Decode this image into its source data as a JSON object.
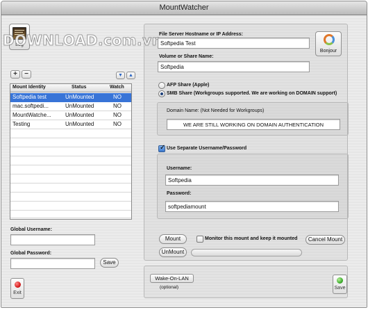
{
  "window": {
    "title": "MountWatcher"
  },
  "watermark": "DOWNLOAD.com.vn",
  "toolbar": {
    "log_label": "Log",
    "exit_label": "Exit",
    "save_label": "Save"
  },
  "table": {
    "headers": [
      "Mount Identity",
      "Status",
      "Watch"
    ],
    "rows": [
      {
        "identity": "Softpedia test",
        "status": "UnMounted",
        "watch": "NO",
        "selected": true
      },
      {
        "identity": "mac.softpedi...",
        "status": "UnMounted",
        "watch": "NO",
        "selected": false
      },
      {
        "identity": "MountWatche...",
        "status": "UnMounted",
        "watch": "NO",
        "selected": false
      },
      {
        "identity": "Testing",
        "status": "UnMounted",
        "watch": "NO",
        "selected": false
      }
    ],
    "add_label": "+",
    "remove_label": "−",
    "move_down_label": "▼",
    "move_up_label": "▲"
  },
  "global": {
    "username_label": "Global Username:",
    "username_value": "",
    "password_label": "Global Password:",
    "password_value": "",
    "save_label": "Save"
  },
  "form": {
    "server_label": "File Server Hostname or IP Address:",
    "server_value": "Softpedia Test",
    "share_label": "Volume or Share Name:",
    "share_value": "Softpedia",
    "bonjour_label": "Bonjour",
    "afp_label": "AFP Share (Apple)",
    "smb_label": "SMB Share (Workgroups supported.  We are working on DOMAIN support)",
    "smb_selected": true,
    "domain_label": "Domain Name:  (Not Needed for Workgroups)",
    "domain_value": "WE ARE STILL WORKING ON DOMAIN AUTHENTICATION",
    "separate_label": "Use Separate Username/Password",
    "separate_checked": true,
    "username_label": "Username:",
    "username_value": "Softpedia",
    "password_label": "Password:",
    "password_value": "softpediamount"
  },
  "actions": {
    "mount_label": "Mount",
    "monitor_label": "Monitor this mount and keep it mounted",
    "monitor_checked": false,
    "cancel_mount_label": "Cancel Mount",
    "unmount_label": "UnMount",
    "progress": 0
  },
  "wol": {
    "label": "Wake-On-LAN",
    "sublabel": "(optional)"
  },
  "colors": {
    "selection": "#3874d7",
    "exit_red": "#d81f1f",
    "save_green": "#3fae2f"
  }
}
